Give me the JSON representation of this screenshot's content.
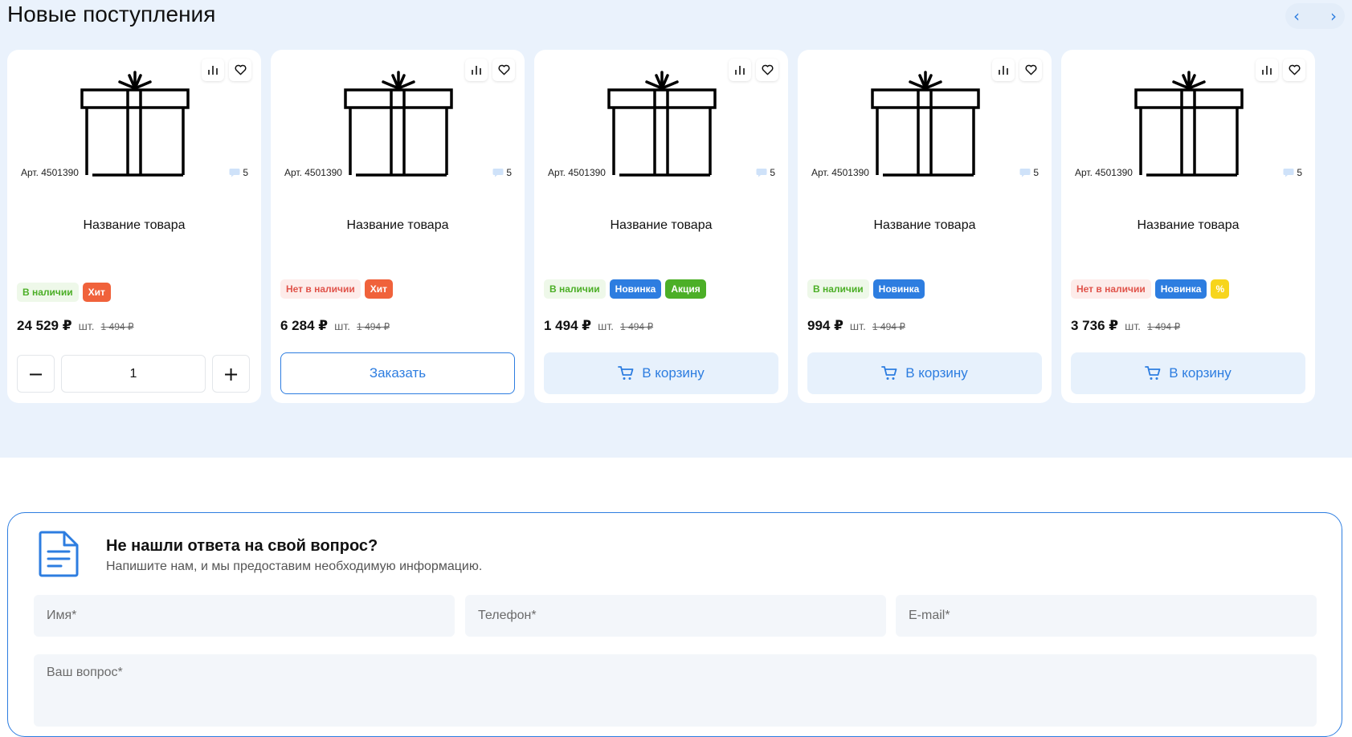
{
  "section": {
    "title": "Новые поступления",
    "prev": "‹",
    "next": "›"
  },
  "products": [
    {
      "art": "Арт. 4501390",
      "reviews": "5",
      "name": "Название товара",
      "badges": [
        {
          "text": "В наличии",
          "kind": "stock"
        },
        {
          "text": "Хит",
          "kind": "hit"
        }
      ],
      "price": "24 529 ₽",
      "unit": "шт.",
      "old_price": "1 494 ₽",
      "action": "qty",
      "qty": "1"
    },
    {
      "art": "Арт. 4501390",
      "reviews": "5",
      "name": "Название товара",
      "badges": [
        {
          "text": "Нет в наличии",
          "kind": "nostock"
        },
        {
          "text": "Хит",
          "kind": "hit"
        }
      ],
      "price": "6 284 ₽",
      "unit": "шт.",
      "old_price": "1 494 ₽",
      "action": "order",
      "action_label": "Заказать"
    },
    {
      "art": "Арт. 4501390",
      "reviews": "5",
      "name": "Название товара",
      "badges": [
        {
          "text": "В наличии",
          "kind": "stock"
        },
        {
          "text": "Новинка",
          "kind": "new"
        },
        {
          "text": "Акция",
          "kind": "sale"
        }
      ],
      "price": "1 494 ₽",
      "unit": "шт.",
      "old_price": "1 494 ₽",
      "action": "cart",
      "action_label": "В корзину"
    },
    {
      "art": "Арт. 4501390",
      "reviews": "5",
      "name": "Название товара",
      "badges": [
        {
          "text": "В наличии",
          "kind": "stock"
        },
        {
          "text": "Новинка",
          "kind": "new"
        }
      ],
      "price": "994 ₽",
      "unit": "шт.",
      "old_price": "1 494 ₽",
      "action": "cart",
      "action_label": "В корзину"
    },
    {
      "art": "Арт. 4501390",
      "reviews": "5",
      "name": "Название товара",
      "badges": [
        {
          "text": "Нет в наличии",
          "kind": "nostock"
        },
        {
          "text": "Новинка",
          "kind": "new"
        },
        {
          "text": "%",
          "kind": "pct"
        }
      ],
      "price": "3 736 ₽",
      "unit": "шт.",
      "old_price": "1 494 ₽",
      "action": "cart",
      "action_label": "В корзину"
    }
  ],
  "form": {
    "title": "Не нашли ответа на свой вопрос?",
    "subtitle": "Напишите нам, и мы предоставим необходимую информацию.",
    "name_placeholder": "Имя*",
    "phone_placeholder": "Телефон*",
    "email_placeholder": "E-mail*",
    "question_placeholder": "Ваш вопрос*"
  },
  "colors": {
    "accent": "#2d7de0",
    "section_bg": "#eaf2fc",
    "stock": "#4caf27",
    "nostock": "#e0534a",
    "hit": "#f0623b",
    "sale": "#4caf27",
    "pct": "#f7d51c"
  },
  "icons": {
    "compare": "bar-chart-icon",
    "favorite": "heart-icon",
    "reviews": "comment-icon",
    "cart": "cart-icon",
    "product": "gift-icon",
    "form": "document-icon"
  }
}
